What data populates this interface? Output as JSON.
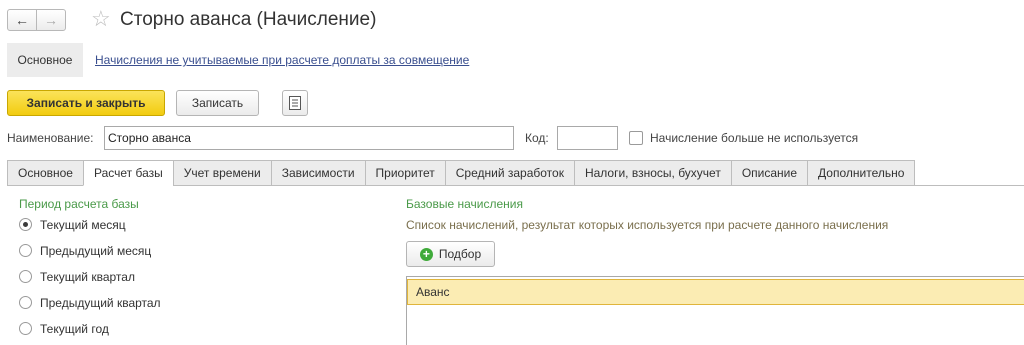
{
  "window": {
    "title": "Сторно аванса (Начисление)",
    "back_icon": "arrow-left-icon",
    "forward_icon": "arrow-right-icon",
    "favorite_icon": "star-icon"
  },
  "section_nav": {
    "current": "Основное",
    "link": "Начисления не учитываемые при расчете доплаты за совмещение"
  },
  "toolbar": {
    "save_close_label": "Записать и закрыть",
    "save_label": "Записать",
    "report_icon": "document-list-icon"
  },
  "form": {
    "name_label": "Наименование:",
    "name_value": "Сторно аванса",
    "code_label": "Код:",
    "code_value": "",
    "not_used_label": "Начисление больше не используется",
    "not_used_checked": false
  },
  "tabs": [
    {
      "label": "Основное"
    },
    {
      "label": "Расчет базы"
    },
    {
      "label": "Учет времени"
    },
    {
      "label": "Зависимости"
    },
    {
      "label": "Приоритет"
    },
    {
      "label": "Средний заработок"
    },
    {
      "label": "Налоги, взносы, бухучет"
    },
    {
      "label": "Описание"
    },
    {
      "label": "Дополнительно"
    }
  ],
  "active_tab": "Расчет базы",
  "period": {
    "title": "Период расчета базы",
    "options": [
      {
        "label": "Текущий месяц",
        "selected": true
      },
      {
        "label": "Предыдущий месяц",
        "selected": false
      },
      {
        "label": "Текущий квартал",
        "selected": false
      },
      {
        "label": "Предыдущий квартал",
        "selected": false
      },
      {
        "label": "Текущий год",
        "selected": false
      }
    ]
  },
  "base": {
    "title": "Базовые начисления",
    "hint": "Список начислений, результат которых используется при расчете данного начисления",
    "pick_label": "Подбор",
    "pick_icon": "add-circle-icon",
    "rows": [
      "Аванс"
    ]
  },
  "colors": {
    "accent_yellow": "#f2cc10",
    "group_title_green": "#4a9a49",
    "link_blue": "#3a4f8f",
    "selected_row": "#fbecb3"
  }
}
